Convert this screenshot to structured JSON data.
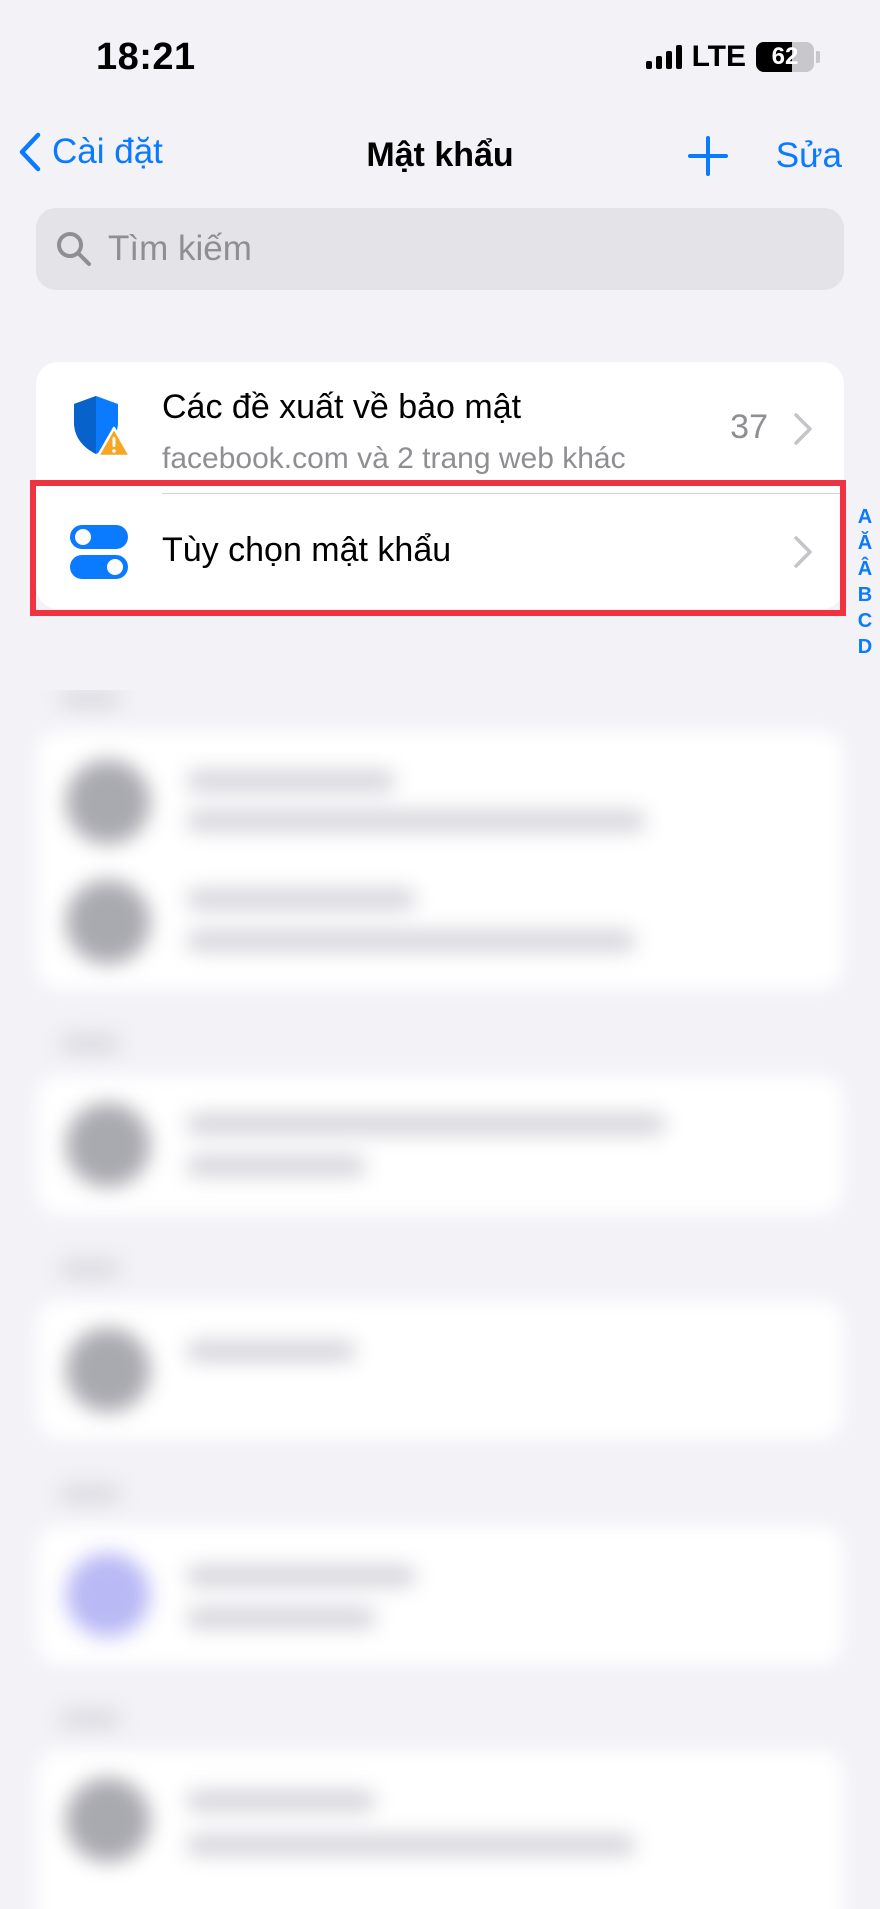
{
  "status_bar": {
    "time": "18:21",
    "network": "LTE",
    "battery": "62",
    "battery_percent": 62
  },
  "nav": {
    "back_label": "Cài đặt",
    "title": "Mật khẩu",
    "edit_label": "Sửa"
  },
  "search": {
    "placeholder": "Tìm kiếm"
  },
  "group": {
    "security": {
      "title": "Các đề xuất về bảo mật",
      "subtitle": "facebook.com và 2 trang web khác",
      "count": "37"
    },
    "options": {
      "title": "Tùy chọn mật khẩu"
    }
  },
  "index_letters": [
    "A",
    "Ă",
    "Â",
    "B",
    "C",
    "D"
  ],
  "colors": {
    "accent": "#0a7aff",
    "highlight": "#ef3340",
    "warning": "#f6a623",
    "background": "#f2f2f7"
  },
  "icons": {
    "back": "chevron-left-icon",
    "add": "plus-icon",
    "search": "search-icon",
    "security": "shield-warning-icon",
    "options": "toggle-icon",
    "disclosure": "chevron-right-icon"
  }
}
